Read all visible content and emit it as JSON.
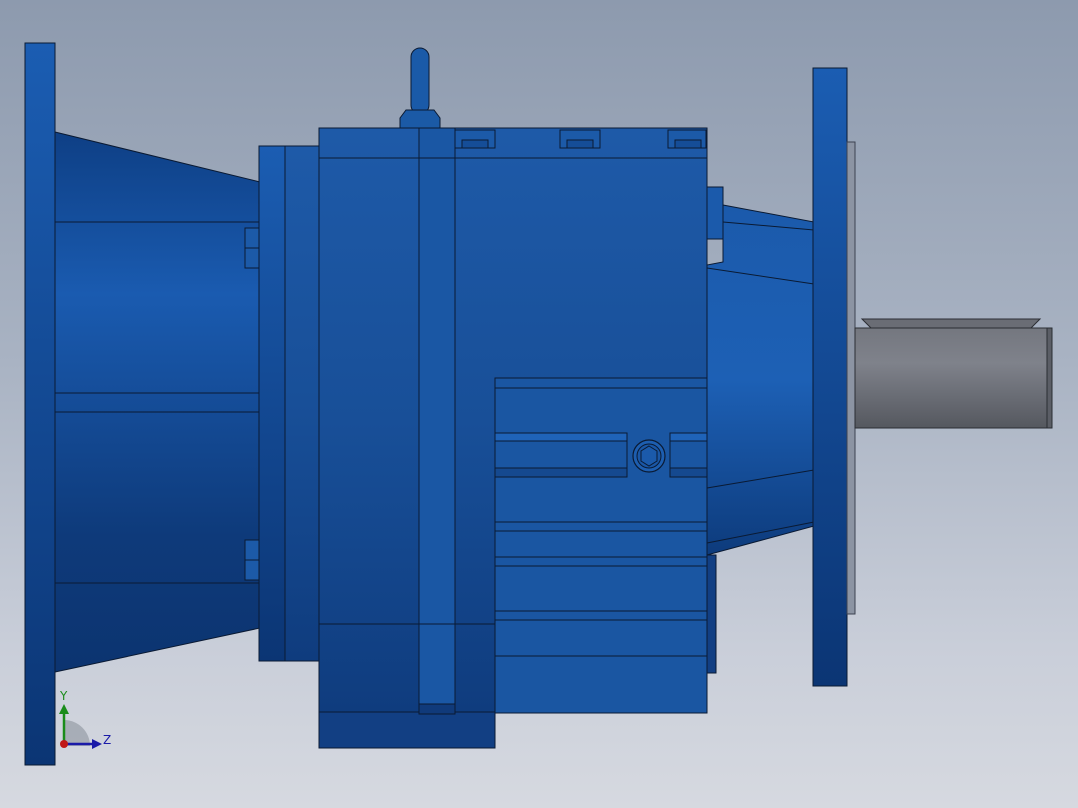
{
  "viewport": {
    "type": "cad-3d-viewport",
    "model": "gear-reducer-side-view",
    "background_colors": [
      "#8d9aae",
      "#d6d9e0"
    ]
  },
  "colors": {
    "housing": "#1f5fae",
    "housing_dark": "#0d3a78",
    "housing_light": "#2c73c6",
    "outline": "#0a1a33",
    "shaft": "#6b6e78",
    "shaft_highlight": "#8a8d96",
    "axis_y": "#1a8c1a",
    "axis_z": "#1a1aa8",
    "axis_x": "#c01818"
  },
  "triad": {
    "y_label": "Y",
    "z_label": "Z",
    "icon": "coordinate-axes-icon"
  }
}
